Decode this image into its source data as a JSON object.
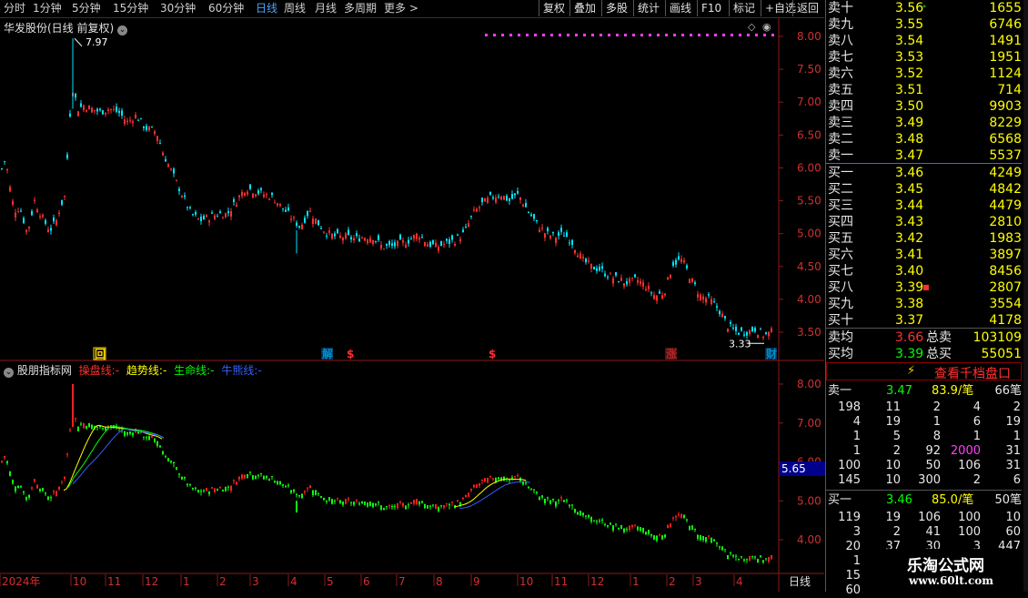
{
  "toolbar": {
    "periods": [
      "分时",
      "1分钟",
      "5分钟",
      "15分钟",
      "30分钟",
      "60分钟",
      "日线",
      "周线",
      "月线",
      "多周期",
      "更多"
    ],
    "active_period": "日线",
    "buttons": [
      "复权",
      "叠加",
      "多股",
      "统计",
      "画线",
      "F10",
      "标记",
      "+自选",
      "返回"
    ]
  },
  "main_chart": {
    "title": "华发股份(日线 前复权)",
    "high_label": "7.97",
    "low_label": "3.33",
    "y_ticks": [
      "8.00",
      "7.50",
      "7.00",
      "6.50",
      "6.00",
      "5.50",
      "5.00",
      "4.50",
      "4.00",
      "3.50"
    ],
    "event_markers": [
      {
        "text": "回",
        "color": "#ffd700"
      },
      {
        "text": "解",
        "color": "#00bfff"
      },
      {
        "text": "$",
        "color": "#ff3030"
      },
      {
        "text": "$",
        "color": "#ff3030"
      },
      {
        "text": "涨",
        "color": "#ff3030"
      },
      {
        "text": "财",
        "color": "#00bfff"
      }
    ]
  },
  "indicator_chart": {
    "title": "股朋指标网",
    "lines": [
      {
        "name": "操盘线:",
        "value": "-",
        "color": "#ff3030"
      },
      {
        "name": "趋势线:",
        "value": "-",
        "color": "#ffff00"
      },
      {
        "name": "生命线:",
        "value": "-",
        "color": "#00ff00"
      },
      {
        "name": "牛熊线:",
        "value": "-",
        "color": "#3060ff"
      }
    ],
    "y_ticks": [
      "8.00",
      "7.00",
      "6.00",
      "5.00",
      "4.00"
    ],
    "current_value": "5.65"
  },
  "x_axis": {
    "labels": [
      "2024年",
      "10",
      "11",
      "12",
      "1",
      "2",
      "3",
      "4",
      "5",
      "6",
      "7",
      "8",
      "9",
      "10",
      "11",
      "12",
      "1",
      "2",
      "3",
      "4"
    ],
    "period": "日线"
  },
  "order_book": {
    "sell": [
      {
        "label": "卖十",
        "price": "3.56",
        "volume": "1655",
        "mark": "*"
      },
      {
        "label": "卖九",
        "price": "3.55",
        "volume": "6746"
      },
      {
        "label": "卖八",
        "price": "3.54",
        "volume": "1491"
      },
      {
        "label": "卖七",
        "price": "3.53",
        "volume": "1951"
      },
      {
        "label": "卖六",
        "price": "3.52",
        "volume": "1124"
      },
      {
        "label": "卖五",
        "price": "3.51",
        "volume": "714"
      },
      {
        "label": "卖四",
        "price": "3.50",
        "volume": "9903"
      },
      {
        "label": "卖三",
        "price": "3.49",
        "volume": "8229"
      },
      {
        "label": "卖二",
        "price": "3.48",
        "volume": "6568"
      },
      {
        "label": "卖一",
        "price": "3.47",
        "volume": "5537"
      }
    ],
    "buy": [
      {
        "label": "买一",
        "price": "3.46",
        "volume": "4249"
      },
      {
        "label": "买二",
        "price": "3.45",
        "volume": "4842"
      },
      {
        "label": "买三",
        "price": "3.44",
        "volume": "4479"
      },
      {
        "label": "买四",
        "price": "3.43",
        "volume": "2810"
      },
      {
        "label": "买五",
        "price": "3.42",
        "volume": "1983"
      },
      {
        "label": "买六",
        "price": "3.41",
        "volume": "3897"
      },
      {
        "label": "买七",
        "price": "3.40",
        "volume": "8456"
      },
      {
        "label": "买八",
        "price": "3.39",
        "volume": "2807",
        "mark": "■"
      },
      {
        "label": "买九",
        "price": "3.38",
        "volume": "3554"
      },
      {
        "label": "买十",
        "price": "3.37",
        "volume": "4178"
      }
    ],
    "sell_avg": {
      "label": "卖均",
      "price": "3.66",
      "total_label": "总卖",
      "total": "103109"
    },
    "buy_avg": {
      "label": "买均",
      "price": "3.39",
      "total_label": "总买",
      "total": "55051"
    }
  },
  "thousand_panel": {
    "button_label": "查看千档盘口",
    "sell1": {
      "label": "卖一",
      "price": "3.47",
      "per": "83.9/笔",
      "count": "66笔"
    },
    "sell_queue": [
      [
        "198",
        "11",
        "2",
        "4",
        "2"
      ],
      [
        "4",
        "19",
        "1",
        "6",
        "19"
      ],
      [
        "1",
        "5",
        "8",
        "1",
        "1"
      ],
      [
        "1",
        "2",
        "92",
        "2000",
        "31"
      ],
      [
        "100",
        "10",
        "50",
        "106",
        "31"
      ],
      [
        "145",
        "10",
        "300",
        "2",
        "6"
      ]
    ],
    "buy1": {
      "label": "买一",
      "price": "3.46",
      "per": "85.0/笔",
      "count": "50笔"
    },
    "buy_queue": [
      [
        "119",
        "19",
        "106",
        "100",
        "10"
      ],
      [
        "3",
        "2",
        "41",
        "100",
        "60"
      ],
      [
        "20",
        "37",
        "30",
        "3",
        "447"
      ],
      [
        "1",
        "1"
      ],
      [
        "15"
      ],
      [
        "60"
      ]
    ]
  },
  "watermark": {
    "name": "乐淘公式网",
    "url": "www.60lt.com"
  },
  "colors": {
    "up": "#ff3030",
    "down": "#00e5ff",
    "price": "#ffff00",
    "active": "#4aa3ff",
    "panel_border": "#8b0000"
  }
}
